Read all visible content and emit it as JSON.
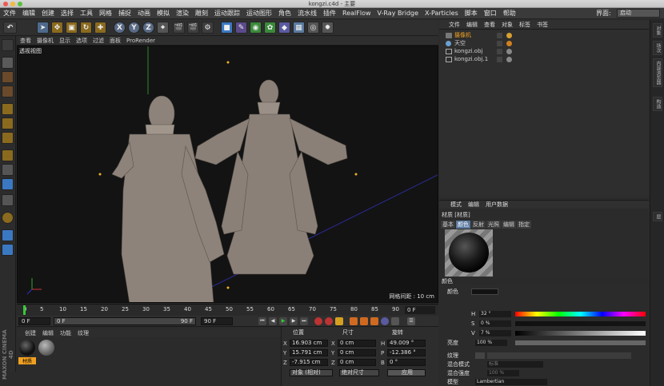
{
  "window": {
    "title": "kongzi.c4d - 主要"
  },
  "menu": {
    "items": [
      "文件",
      "编辑",
      "创建",
      "选择",
      "工具",
      "网格",
      "捕捉",
      "动画",
      "模拟",
      "渲染",
      "雕刻",
      "运动跟踪",
      "运动图形",
      "角色",
      "流水线",
      "插件",
      "RealFlow",
      "V-Ray Bridge",
      "X-Particles",
      "脚本",
      "窗口",
      "帮助"
    ],
    "layout_label": "界面:",
    "layout_value": "启动"
  },
  "toolbar": {
    "icons": [
      "undo-icon",
      "select-icon",
      "move-icon",
      "scale-icon",
      "rotate-icon",
      "move-add-icon",
      "x-axis-icon",
      "y-axis-icon",
      "z-axis-icon",
      "coord-system-icon",
      "render-view-icon",
      "render-picture-icon",
      "render-settings-icon",
      "cube-icon",
      "spline-pen-icon",
      "subdivision-icon",
      "array-icon",
      "deformer-icon",
      "scene-floor-icon",
      "camera-icon",
      "light-icon"
    ]
  },
  "viewport": {
    "menu": [
      "查看",
      "摄像机",
      "显示",
      "选项",
      "过滤",
      "面板",
      "ProRender"
    ],
    "label": "透视视图",
    "grid_info": "网格间距 : 10 cm"
  },
  "timeline": {
    "ticks": [
      "0",
      "5",
      "10",
      "15",
      "20",
      "25",
      "30",
      "35",
      "40",
      "45",
      "50",
      "55",
      "60",
      "65",
      "70",
      "75",
      "80",
      "85",
      "90"
    ],
    "frame": "0 F"
  },
  "transport": {
    "start": "0 F",
    "slider_value": "0 F",
    "end_inner": "90 F",
    "end": "90 F"
  },
  "materials": {
    "menu": [
      "创建",
      "编辑",
      "功能",
      "纹理"
    ],
    "items": [
      {
        "label": "材质"
      },
      {
        "label": ""
      }
    ],
    "brand": "MAXON CINEMA 4D"
  },
  "coordinates": {
    "headers": {
      "position": "位置",
      "size": "尺寸",
      "rotation": "旋转"
    },
    "rows": [
      {
        "axis": "X",
        "pos": "16.903 cm",
        "size": "0 cm",
        "rot_label": "H",
        "rot": "49.009 °"
      },
      {
        "axis": "Y",
        "pos": "15.791 cm",
        "size": "0 cm",
        "rot_label": "P",
        "rot": "-12.386 °"
      },
      {
        "axis": "Z",
        "pos": "-7.915 cm",
        "size": "0 cm",
        "rot_label": "B",
        "rot": "0 °"
      }
    ],
    "mode": "对象 (相对)",
    "size_mode": "绝对尺寸",
    "apply": "应用"
  },
  "object_manager": {
    "menu": [
      "文件",
      "编辑",
      "查看",
      "对象",
      "标签",
      "书签"
    ],
    "objects": [
      {
        "name": "摄像机",
        "color": "#f0a020"
      },
      {
        "name": "天空",
        "color": "#d0d0d0"
      },
      {
        "name": "kongzi.obj",
        "color": "#d0d0d0"
      },
      {
        "name": "kongzi.obj.1",
        "color": "#d0d0d0"
      }
    ]
  },
  "side_tabs": [
    "对象",
    "场次",
    "内容浏览器",
    "构造",
    "层"
  ],
  "attributes": {
    "menu": [
      "模式",
      "编辑",
      "用户数据"
    ],
    "title": "材质 [材质]",
    "tabs": [
      "基本",
      "颜色",
      "反射",
      "光照",
      "编辑",
      "指定"
    ],
    "active_tab": "颜色",
    "section": "颜色",
    "color_label": "颜色",
    "hsv": [
      {
        "label": "H",
        "value": "32 °"
      },
      {
        "label": "S",
        "value": "0 %"
      },
      {
        "label": "V",
        "value": "7 %"
      }
    ],
    "brightness_label": "亮度",
    "brightness_value": "100 %",
    "texture_label": "纹理",
    "mix_mode_label": "混合模式",
    "mix_mode_value": "标准",
    "mix_strength_label": "混合强度",
    "mix_strength_value": "100 %",
    "model_label": "模型",
    "model_value": "Lambertian"
  }
}
